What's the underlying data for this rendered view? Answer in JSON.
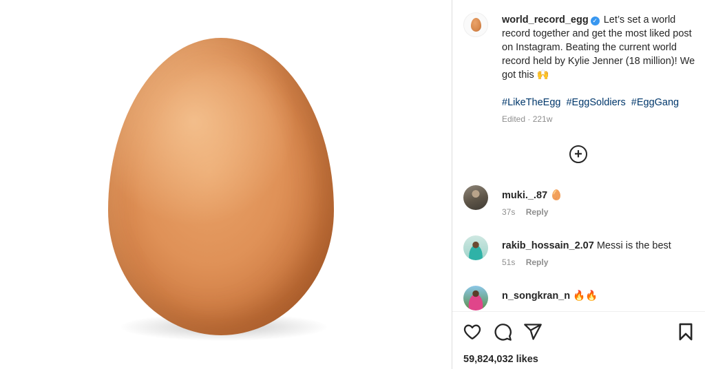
{
  "post": {
    "username": "world_record_egg",
    "verified": true,
    "caption_text": "Let’s set a world record together and get the most liked post on Instagram. Beating the current world record held by Kylie Jenner (18 million)! We got this 🙌",
    "hashtags": [
      "#LikeTheEgg",
      "#EggSoldiers",
      "#EggGang"
    ],
    "edited_meta": "Edited · 221w",
    "likes_text": "59,824,032 likes"
  },
  "comments": [
    {
      "username": "muki._.87",
      "text": "🥚",
      "time": "37s",
      "reply_label": "Reply"
    },
    {
      "username": "rakib_hossain_2.07",
      "text": "Messi is the best",
      "time": "51s",
      "reply_label": "Reply"
    },
    {
      "username": "n_songkran_n",
      "text": "🔥🔥",
      "time": "",
      "reply_label": ""
    }
  ],
  "icons": {
    "load_more": "plus-circle-icon",
    "like": "heart-icon",
    "comment": "comment-bubble-icon",
    "share": "paper-plane-icon",
    "save": "bookmark-icon",
    "verified": "verified-badge-icon"
  },
  "colors": {
    "hashtag": "#00376b",
    "verified": "#3897f0",
    "muted": "#8e8e8e",
    "text": "#262626"
  }
}
